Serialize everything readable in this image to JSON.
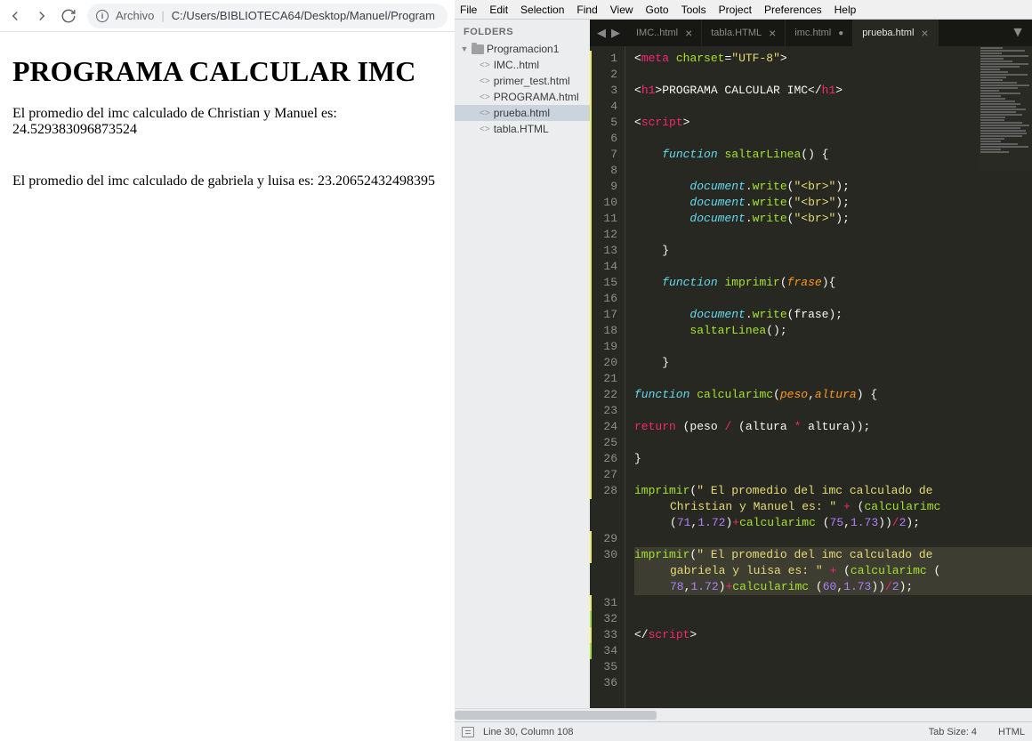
{
  "browser": {
    "url_label": "Archivo",
    "url_path": "C:/Users/BIBLIOTECA64/Desktop/Manuel/Program",
    "heading": "PROGRAMA CALCULAR IMC",
    "para1": "El promedio del imc calculado de Christian y Manuel es: 24.529383096873524",
    "para2": "El promedio del imc calculado de gabriela y luisa es: 23.20652432498395"
  },
  "menus": [
    "File",
    "Edit",
    "Selection",
    "Find",
    "View",
    "Goto",
    "Tools",
    "Project",
    "Preferences",
    "Help"
  ],
  "sidebar": {
    "title": "FOLDERS",
    "folder": "Programacion1",
    "files": [
      "IMC..html",
      "primer_test.html",
      "PROGRAMA.html",
      "prueba.html",
      "tabla.HTML"
    ],
    "active_index": 3
  },
  "tabs": [
    {
      "label": "IMC..html",
      "modified": false,
      "active": false
    },
    {
      "label": "tabla.HTML",
      "modified": false,
      "active": false
    },
    {
      "label": "imc.html",
      "modified": true,
      "active": false
    },
    {
      "label": "prueba.html",
      "modified": false,
      "active": true
    }
  ],
  "code": {
    "lines": [
      {
        "n": 1,
        "mod": true,
        "html": "<span class='c-plain'>&lt;</span><span class='c-tag'>meta</span> <span class='c-attr'>charset</span><span class='c-plain'>=</span><span class='c-str'>\"UTF-8\"</span><span class='c-plain'>&gt;</span>"
      },
      {
        "n": 2,
        "mod": true,
        "html": ""
      },
      {
        "n": 3,
        "mod": true,
        "html": "<span class='c-plain'>&lt;</span><span class='c-tag'>h1</span><span class='c-plain'>&gt;PROGRAMA CALCULAR IMC&lt;/</span><span class='c-tag'>h1</span><span class='c-plain'>&gt;</span>"
      },
      {
        "n": 4,
        "mod": true,
        "html": ""
      },
      {
        "n": 5,
        "mod": true,
        "html": "<span class='c-plain'>&lt;</span><span class='c-tag'>script</span><span class='c-plain'>&gt;</span>"
      },
      {
        "n": 6,
        "mod": true,
        "html": ""
      },
      {
        "n": 7,
        "mod": true,
        "html": "    <span class='c-kw'>function</span> <span class='c-fn'>saltarLinea</span><span class='c-plain'>() {</span>"
      },
      {
        "n": 8,
        "mod": true,
        "html": ""
      },
      {
        "n": 9,
        "mod": true,
        "html": "        <span class='c-obj'>document</span><span class='c-plain'>.</span><span class='c-fn'>write</span><span class='c-plain'>(</span><span class='c-str'>\"&lt;br&gt;\"</span><span class='c-plain'>);</span>"
      },
      {
        "n": 10,
        "mod": true,
        "html": "        <span class='c-obj'>document</span><span class='c-plain'>.</span><span class='c-fn'>write</span><span class='c-plain'>(</span><span class='c-str'>\"&lt;br&gt;\"</span><span class='c-plain'>);</span>"
      },
      {
        "n": 11,
        "mod": true,
        "html": "        <span class='c-obj'>document</span><span class='c-plain'>.</span><span class='c-fn'>write</span><span class='c-plain'>(</span><span class='c-str'>\"&lt;br&gt;\"</span><span class='c-plain'>);</span>"
      },
      {
        "n": 12,
        "mod": true,
        "html": ""
      },
      {
        "n": 13,
        "mod": true,
        "html": "    <span class='c-plain'>}</span>"
      },
      {
        "n": 14,
        "mod": true,
        "html": ""
      },
      {
        "n": 15,
        "mod": true,
        "html": "    <span class='c-kw'>function</span> <span class='c-fn'>imprimir</span><span class='c-plain'>(</span><span class='c-var'>frase</span><span class='c-plain'>){</span>"
      },
      {
        "n": 16,
        "mod": true,
        "html": ""
      },
      {
        "n": 17,
        "mod": true,
        "html": "        <span class='c-obj'>document</span><span class='c-plain'>.</span><span class='c-fn'>write</span><span class='c-plain'>(frase);</span>"
      },
      {
        "n": 18,
        "mod": true,
        "html": "        <span class='c-fn'>saltarLinea</span><span class='c-plain'>();</span>"
      },
      {
        "n": 19,
        "mod": true,
        "html": ""
      },
      {
        "n": 20,
        "mod": true,
        "html": "    <span class='c-plain'>}</span>"
      },
      {
        "n": 21,
        "mod": true,
        "html": ""
      },
      {
        "n": 22,
        "mod": true,
        "html": "<span class='c-kw'>function</span> <span class='c-fn'>calcularimc</span><span class='c-plain'>(</span><span class='c-var'>peso</span><span class='c-plain'>,</span><span class='c-var'>altura</span><span class='c-plain'>) {</span>"
      },
      {
        "n": 23,
        "mod": true,
        "html": ""
      },
      {
        "n": 24,
        "mod": true,
        "html": "<span class='c-tag'>return</span> <span class='c-plain'>(peso </span><span class='c-op'>/</span><span class='c-plain'> (altura </span><span class='c-op'>*</span><span class='c-plain'> altura));</span>"
      },
      {
        "n": 25,
        "mod": true,
        "html": ""
      },
      {
        "n": 26,
        "mod": true,
        "html": "<span class='c-plain'>}</span>"
      },
      {
        "n": 27,
        "mod": true,
        "html": ""
      },
      {
        "n": 28,
        "mod": true,
        "html": "<span class='c-fn'>imprimir</span><span class='c-plain'>(</span><span class='c-str'>\" El promedio del imc calculado de </span>"
      },
      {
        "n": 28,
        "cont": true,
        "html": "<span class='c-str'>Christian y Manuel es: \"</span> <span class='c-op'>+</span> <span class='c-plain'>(</span><span class='c-fn'>calcularimc</span>"
      },
      {
        "n": 28,
        "cont": true,
        "html": "<span class='c-plain'>(</span><span class='c-num'>71</span><span class='c-plain'>,</span><span class='c-num'>1.72</span><span class='c-plain'>)</span><span class='c-op'>+</span><span class='c-fn'>calcularimc</span> <span class='c-plain'>(</span><span class='c-num'>75</span><span class='c-plain'>,</span><span class='c-num'>1.73</span><span class='c-plain'>))</span><span class='c-op'>/</span><span class='c-num'>2</span><span class='c-plain'>);</span>"
      },
      {
        "n": 29,
        "mod": true,
        "html": ""
      },
      {
        "n": 30,
        "mod": true,
        "highlight": true,
        "html": "<span class='c-fn'>imprimir</span><span class='c-plain'>(</span><span class='c-str'>\" El promedio del imc calculado de </span>"
      },
      {
        "n": 30,
        "cont": true,
        "highlight": true,
        "html": "<span class='c-str'>gabriela y luisa es: \"</span> <span class='c-op'>+</span> <span class='c-plain'>(</span><span class='c-fn'>calcularimc</span> <span class='c-plain'>(</span>"
      },
      {
        "n": 30,
        "cont": true,
        "highlight": true,
        "html": "<span class='c-num'>78</span><span class='c-plain'>,</span><span class='c-num'>1.72</span><span class='c-plain'>)</span><span class='c-op'>+</span><span class='c-fn'>calcularimc</span> <span class='c-plain'>(</span><span class='c-num'>60</span><span class='c-plain'>,</span><span class='c-num'>1.73</span><span class='c-plain'>))</span><span class='c-op'>/</span><span class='c-num'>2</span><span class='c-plain'>);</span>"
      },
      {
        "n": 31,
        "mod": true,
        "html": ""
      },
      {
        "n": 32,
        "add": true,
        "html": ""
      },
      {
        "n": 33,
        "mod": true,
        "html": "<span class='c-plain'>&lt;/</span><span class='c-tag'>script</span><span class='c-plain'>&gt;</span>"
      },
      {
        "n": 34,
        "add": true,
        "html": ""
      },
      {
        "n": 35,
        "html": ""
      },
      {
        "n": 36,
        "html": ""
      }
    ]
  },
  "status": {
    "position": "Line 30, Column 108",
    "tab_size": "Tab Size: 4",
    "syntax": "HTML"
  }
}
